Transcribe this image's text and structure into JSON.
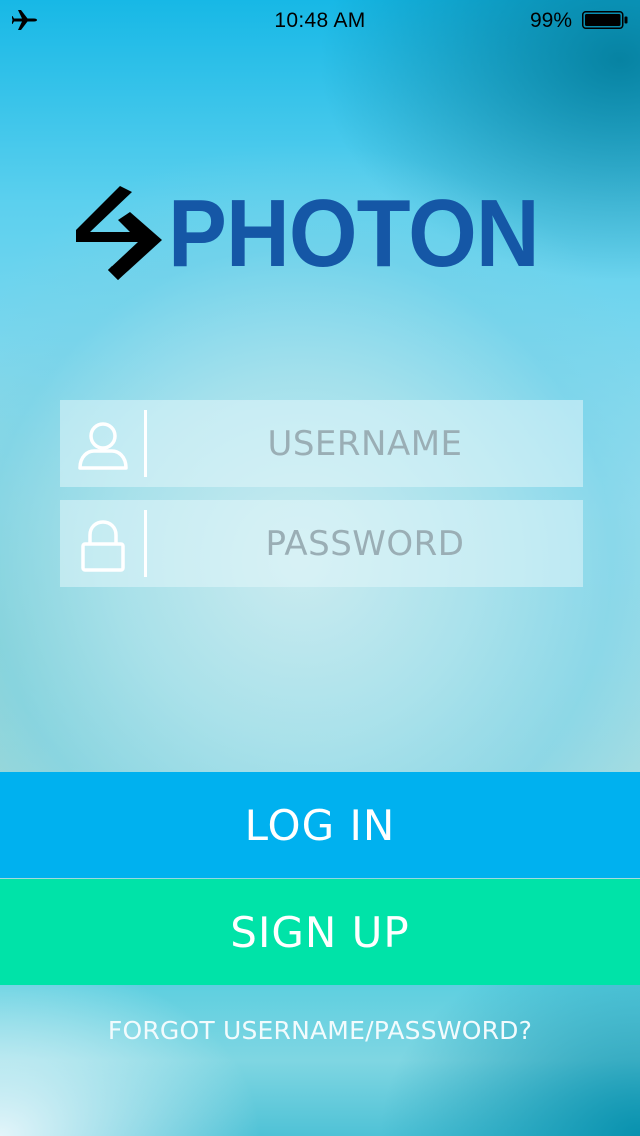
{
  "status_bar": {
    "airplane_icon": "airplane-icon",
    "time": "10:48 AM",
    "battery_percent": "99%",
    "battery_icon": "battery-icon"
  },
  "logo": {
    "text": "PHOTON",
    "mark_icon": "photon-logo-mark",
    "text_color": "#1557a6"
  },
  "login_form": {
    "username": {
      "icon": "user-icon",
      "placeholder": "USERNAME",
      "value": ""
    },
    "password": {
      "icon": "lock-icon",
      "placeholder": "PASSWORD",
      "value": ""
    }
  },
  "actions": {
    "login_label": "LOG IN",
    "login_color": "#00b1ef",
    "signup_label": "SIGN UP",
    "signup_color": "#00e3a8",
    "forgot_label": "FORGOT USERNAME/PASSWORD?"
  }
}
